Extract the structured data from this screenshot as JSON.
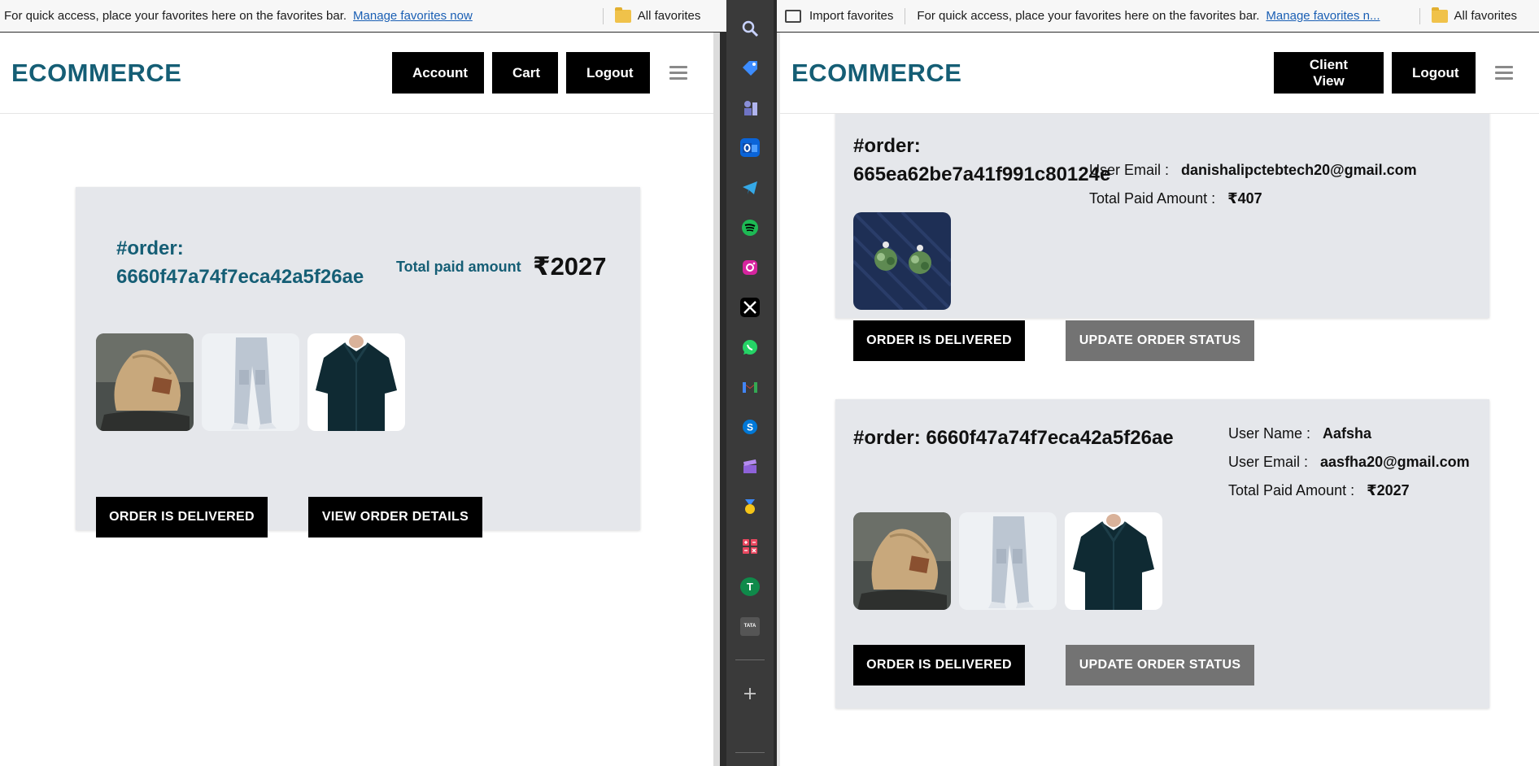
{
  "favbar_left": {
    "message": "For quick access, place your favorites here on the favorites bar.",
    "manage_link": "Manage favorites now",
    "all_favorites": "All favorites"
  },
  "favbar_right": {
    "import": "Import favorites",
    "message": "For quick access, place your favorites here on the favorites bar.",
    "manage_link": "Manage favorites n...",
    "all_favorites": "All favorites"
  },
  "left": {
    "logo": "ECOMMERCE",
    "nav": [
      "Account",
      "Cart",
      "Logout"
    ],
    "order": {
      "label": "#order:",
      "id": "6660f47a74f7eca42a5f26ae",
      "total_label": "Total paid amount",
      "total": "₹2027",
      "products": [
        "shoe",
        "cargo-pants",
        "shirt"
      ],
      "delivered_btn": "ORDER IS DELIVERED",
      "details_btn": "VIEW ORDER DETAILS"
    }
  },
  "right": {
    "logo": "ECOMMERCE",
    "nav": [
      "Client View",
      "Logout"
    ],
    "orders": [
      {
        "label": "#order:",
        "id": "665ea62be7a41f991c80124e",
        "email_label": "User Email :",
        "email": "danishalipctebtech20@gmail.com",
        "total_label": "Total Paid Amount :",
        "total": "₹407",
        "products": [
          "earrings"
        ],
        "delivered_btn": "ORDER IS DELIVERED",
        "update_btn": "UPDATE ORDER STATUS"
      },
      {
        "title": "#order: 6660f47a74f7eca42a5f26ae",
        "name_label": "User Name :",
        "name": "Aafsha",
        "email_label": "User Email :",
        "email": "aasfha20@gmail.com",
        "total_label": "Total Paid Amount :",
        "total": "₹2027",
        "products": [
          "shoe",
          "cargo-pants",
          "shirt"
        ],
        "delivered_btn": "ORDER IS DELIVERED",
        "update_btn": "UPDATE ORDER STATUS"
      }
    ]
  },
  "sidebar_icons": [
    "search-icon",
    "tag-icon",
    "chess-icon",
    "outlook-icon",
    "telegram-icon",
    "spotify-icon",
    "instagram-icon",
    "x-icon",
    "whatsapp-icon",
    "gmail-icon",
    "skype-icon",
    "clapper-icon",
    "medal-icon",
    "calculator-icon",
    "t-app-icon",
    "tata-icon",
    "add-icon"
  ],
  "sidebar_letters": {
    "t_app": "T",
    "tata": "TATA"
  },
  "colors": {
    "brand": "#155e75",
    "card": "#e5e7eb",
    "button": "#000000",
    "button_grey": "#737373"
  }
}
